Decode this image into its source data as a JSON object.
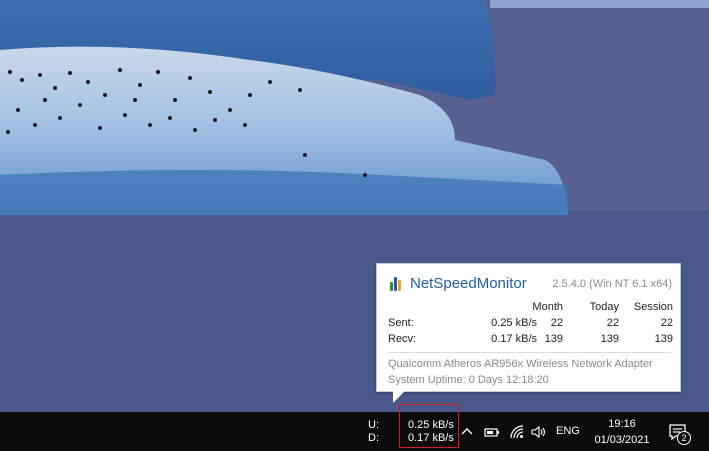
{
  "popup": {
    "app_name": "NetSpeedMonitor",
    "version": "2.5.4.0 (Win NT 6.1 x64)",
    "columns": {
      "month": "Month",
      "today": "Today",
      "session": "Session"
    },
    "rows": [
      {
        "label": "Sent:",
        "rate": "0.25 kB/s",
        "month": "22",
        "today": "22",
        "session": "22"
      },
      {
        "label": "Recv:",
        "rate": "0.17 kB/s",
        "month": "139",
        "today": "139",
        "session": "139"
      }
    ],
    "adapter": "Qualcomm Atheros AR956x Wireless Network Adapter",
    "uptime": "System Uptime: 0 Days 12:18:20"
  },
  "taskbar": {
    "upload_label": "U:",
    "download_label": "D:",
    "upload_speed": "0.25 kB/s",
    "download_speed": "0.17 kB/s",
    "language": "ENG",
    "time": "19:16",
    "date": "01/03/2021",
    "notification_count": "2",
    "icons": [
      "chevron-up-icon",
      "battery-icon",
      "wifi-icon",
      "speaker-icon",
      "notification-icon"
    ]
  },
  "colors": {
    "brand": "#1f5fa8",
    "highlight_box": "#d41a1a",
    "taskbar": "#0b0b0b"
  }
}
